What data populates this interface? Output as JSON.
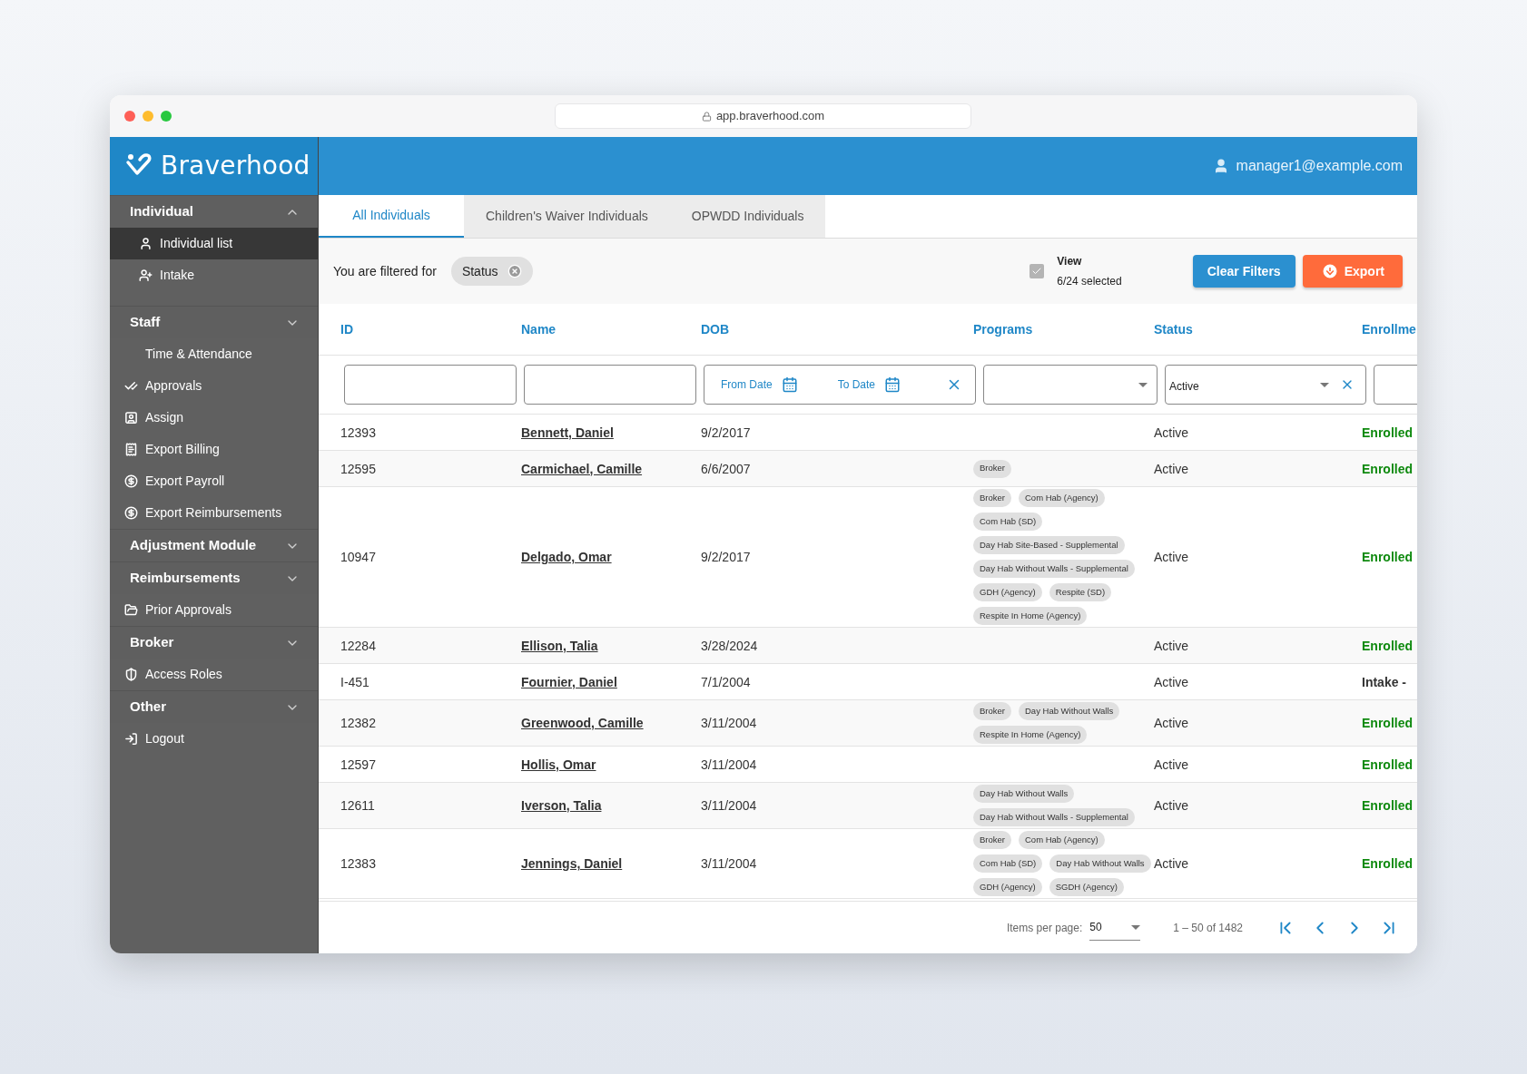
{
  "browser": {
    "url": "app.braverhood.com"
  },
  "brand": "Braverhood",
  "user": "manager1@example.com",
  "sidebar": {
    "items": [
      {
        "kind": "group",
        "label": "Individual",
        "expanded": true
      },
      {
        "kind": "link",
        "label": "Individual list",
        "selected": true,
        "indent": true
      },
      {
        "kind": "link",
        "label": "Intake",
        "selected": false,
        "indent": true
      },
      {
        "kind": "group",
        "label": "Staff",
        "expanded": false
      },
      {
        "kind": "link",
        "label": "Time & Attendance",
        "selected": false
      },
      {
        "kind": "link",
        "label": "Approvals",
        "selected": false
      },
      {
        "kind": "link",
        "label": "Assign",
        "selected": false
      },
      {
        "kind": "link",
        "label": "Export Billing",
        "selected": false
      },
      {
        "kind": "link",
        "label": "Export Payroll",
        "selected": false
      },
      {
        "kind": "link",
        "label": "Export Reimbursements",
        "selected": false
      },
      {
        "kind": "group",
        "label": "Adjustment Module",
        "expanded": false
      },
      {
        "kind": "group",
        "label": "Reimbursements",
        "expanded": false
      },
      {
        "kind": "link",
        "label": "Prior Approvals",
        "selected": false
      },
      {
        "kind": "group",
        "label": "Broker",
        "expanded": false
      },
      {
        "kind": "link",
        "label": "Access Roles",
        "selected": false
      },
      {
        "kind": "group",
        "label": "Other",
        "expanded": false
      },
      {
        "kind": "link",
        "label": "Logout",
        "selected": false
      }
    ]
  },
  "tabs": [
    {
      "label": "All Individuals",
      "selected": true
    },
    {
      "label": "Children's Waiver Individuals",
      "selected": false
    },
    {
      "label": "OPWDD Individuals",
      "selected": false
    }
  ],
  "filter_bar": {
    "label": "You are filtered for",
    "chips": [
      "Status"
    ],
    "view": {
      "checked": true,
      "title": "View",
      "count": "6/24 selected"
    },
    "buttons": [
      "Clear Filters",
      "Export"
    ]
  },
  "table": {
    "columns": [
      "ID",
      "Name",
      "DOB",
      "Programs",
      "Status",
      "Enrollme"
    ],
    "filters": {
      "from_placeholder": "From Date",
      "to_placeholder": "To Date",
      "status_value": "Active"
    },
    "rows": [
      {
        "id": "12393",
        "name": "Bennett, Daniel",
        "dob": "9/2/2017",
        "programs": [],
        "status": "Active",
        "enrollment": {
          "text": "Enrolled",
          "kind": "enrolled"
        }
      },
      {
        "id": "12595",
        "name": "Carmichael, Camille",
        "dob": "6/6/2007",
        "programs": [
          "Broker"
        ],
        "status": "Active",
        "enrollment": {
          "text": "Enrolled",
          "kind": "enrolled"
        }
      },
      {
        "id": "10947",
        "name": "Delgado, Omar",
        "dob": "9/2/2017",
        "programs": [
          "Broker",
          "Com Hab (Agency)",
          "Com Hab (SD)",
          "Day Hab Site-Based - Supplemental",
          "Day Hab Without Walls - Supplemental",
          "GDH (Agency)",
          "Respite (SD)",
          "Respite In Home (Agency)"
        ],
        "status": "Active",
        "enrollment": {
          "text": "Enrolled",
          "kind": "enrolled"
        }
      },
      {
        "id": "12284",
        "name": "Ellison, Talia",
        "dob": "3/28/2024",
        "programs": [],
        "status": "Active",
        "enrollment": {
          "text": "Enrolled",
          "kind": "enrolled"
        }
      },
      {
        "id": "I-451",
        "name": "Fournier, Daniel",
        "dob": "7/1/2004",
        "programs": [],
        "status": "Active",
        "enrollment": {
          "text": "Intake -",
          "kind": "intake"
        }
      },
      {
        "id": "12382",
        "name": "Greenwood, Camille",
        "dob": "3/11/2004",
        "programs": [
          "Broker",
          "Day Hab Without Walls",
          "Respite In Home (Agency)"
        ],
        "status": "Active",
        "enrollment": {
          "text": "Enrolled",
          "kind": "enrolled"
        }
      },
      {
        "id": "12597",
        "name": "Hollis, Omar",
        "dob": "3/11/2004",
        "programs": [],
        "status": "Active",
        "enrollment": {
          "text": "Enrolled",
          "kind": "enrolled"
        }
      },
      {
        "id": "12611",
        "name": "Iverson, Talia",
        "dob": "3/11/2004",
        "programs": [
          "Day Hab Without Walls",
          "Day Hab Without Walls - Supplemental"
        ],
        "status": "Active",
        "enrollment": {
          "text": "Enrolled",
          "kind": "enrolled"
        }
      },
      {
        "id": "12383",
        "name": "Jennings, Daniel",
        "dob": "3/11/2004",
        "programs": [
          "Broker",
          "Com Hab (Agency)",
          "Com Hab (SD)",
          "Day Hab Without Walls",
          "GDH (Agency)",
          "SGDH (Agency)"
        ],
        "status": "Active",
        "enrollment": {
          "text": "Enrolled",
          "kind": "enrolled"
        }
      }
    ]
  },
  "pagination": {
    "label": "Items per page:",
    "page_size": "50",
    "range": "1 – 50 of 1482"
  }
}
